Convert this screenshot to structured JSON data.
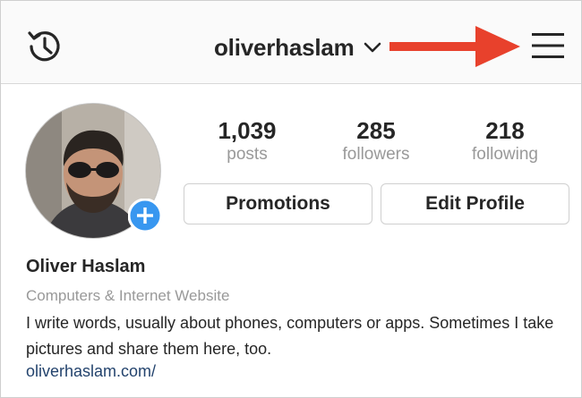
{
  "header": {
    "username": "oliverhaslam",
    "accent_arrow_color": "#e8412c",
    "icons": {
      "history": "history-icon",
      "dropdown": "chevron-down-icon",
      "menu": "hamburger-menu-icon"
    }
  },
  "profile": {
    "avatar": "avatar",
    "add_badge_color": "#3897f0",
    "stats": {
      "posts": {
        "count": "1,039",
        "label": "posts"
      },
      "followers": {
        "count": "285",
        "label": "followers"
      },
      "following": {
        "count": "218",
        "label": "following"
      }
    },
    "buttons": {
      "promotions": "Promotions",
      "edit_profile": "Edit Profile"
    },
    "name": "Oliver Haslam",
    "category": "Computers & Internet Website",
    "bio": "I write words, usually about phones, computers or apps. Sometimes I take pictures and share them here, too.",
    "website": "oliverhaslam.com/"
  }
}
